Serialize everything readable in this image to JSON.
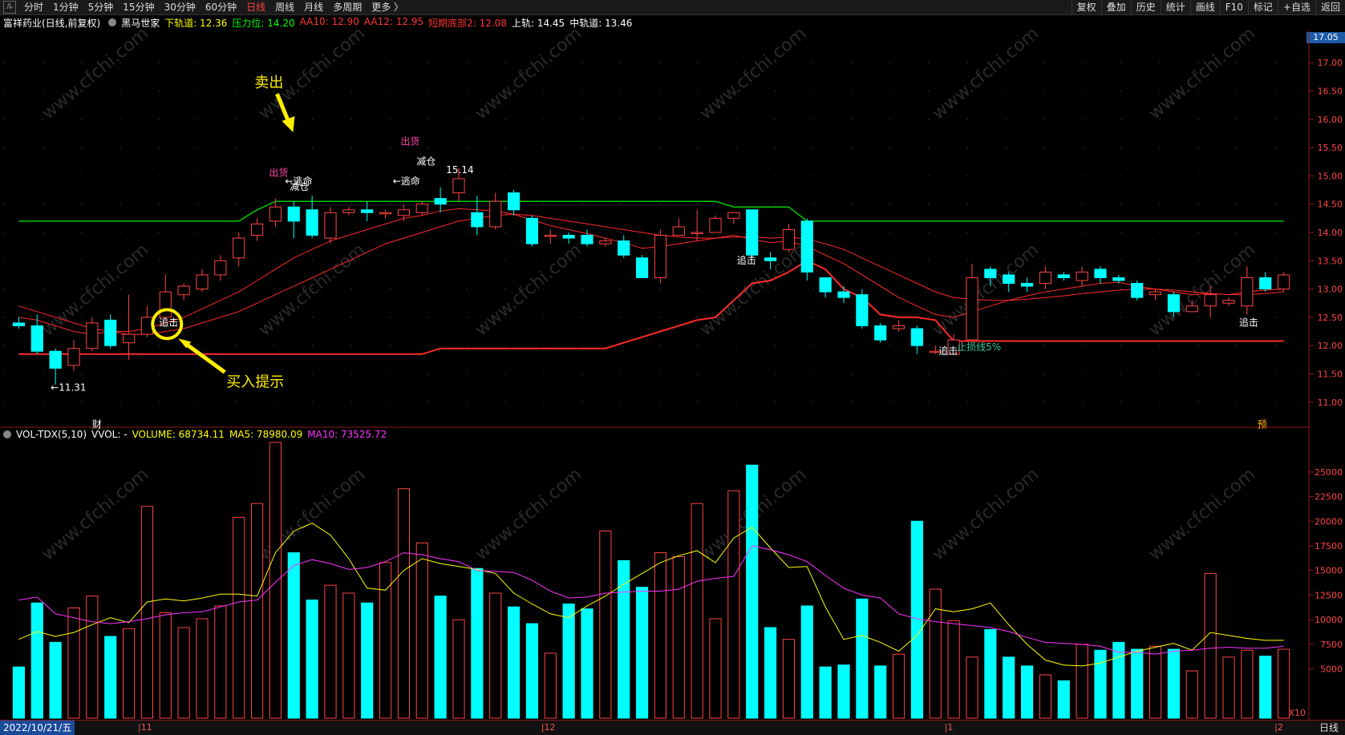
{
  "topbar": {
    "logo": "ル",
    "tabs": [
      "分时",
      "1分钟",
      "5分钟",
      "15分钟",
      "30分钟",
      "60分钟",
      "日线",
      "周线",
      "月线",
      "多周期",
      "更多 〉"
    ],
    "active_tab": "日线",
    "right_buttons": [
      "复权",
      "叠加",
      "历史",
      "统计",
      "画线",
      "F10",
      "标记",
      "+自选",
      "返回"
    ]
  },
  "info": {
    "title": "富祥药业(日线,前复权)",
    "indicator": "黑马世家",
    "items": [
      {
        "label": "下轨道: 12.36",
        "color": "#ffff00"
      },
      {
        "label": "压力位: 14.20",
        "color": "#00ff00"
      },
      {
        "label": "AA10: 12.90",
        "color": "#ff3333"
      },
      {
        "label": "AA12: 12.95",
        "color": "#ff3333"
      },
      {
        "label": "短期底部2: 12.08",
        "color": "#ff3333"
      },
      {
        "label": "上轨: 14.45",
        "color": "#ffffff"
      },
      {
        "label": "中轨道: 13.46",
        "color": "#ffffff"
      }
    ],
    "current_price": "17.05"
  },
  "vol_info": {
    "name": "VOL-TDX(5,10)",
    "vvol": "VVOL: -",
    "volume": "VOLUME: 68734.11",
    "ma5": "MA5: 78980.09",
    "ma10": "MA10: 73525.72"
  },
  "annotations": {
    "sell_label": "卖出",
    "buy_label": "买入提示",
    "chuhuo1": "出货",
    "chuhuo2": "出货",
    "jiancang1": "减仓",
    "jiancang2": "减仓",
    "taoming1": "←逃命",
    "taoming2": "←逃命",
    "zhuiji1": "追击",
    "zhuiji2": "追击",
    "zhuiji3": "追击",
    "zhuiji4": "追击",
    "low_label": "←11.31",
    "high_label": "15.14",
    "zhisun": "止损线5%",
    "cai": "财",
    "yu": "预",
    "x10": "X10",
    "watermark": "www.cfchi.com"
  },
  "bottom": {
    "date": "2022/10/21/五",
    "months": [
      "11",
      "12",
      "1",
      "2"
    ],
    "period": "日线"
  },
  "colors": {
    "up": "#ff4444",
    "down": "#00ffff",
    "ma_red": "#ff2a2a",
    "resist": "#00cc00",
    "ma5": "#ffff00",
    "ma10": "#ff33ff"
  },
  "chart_data": [
    {
      "type": "candlestick",
      "yaxis_ticks": [
        11.0,
        11.5,
        12.0,
        12.5,
        13.0,
        13.5,
        14.0,
        14.5,
        15.0,
        15.5,
        16.0,
        16.5,
        17.0
      ],
      "ylim": [
        10.6,
        17.4
      ],
      "candles": [
        [
          12.4,
          12.35,
          12.5,
          12.3
        ],
        [
          12.35,
          11.9,
          12.55,
          11.85
        ],
        [
          11.9,
          11.6,
          11.95,
          11.31
        ],
        [
          11.65,
          11.95,
          12.1,
          11.55
        ],
        [
          11.95,
          12.4,
          12.5,
          11.9
        ],
        [
          12.45,
          12.0,
          12.55,
          11.95
        ],
        [
          12.05,
          12.2,
          12.9,
          11.75
        ],
        [
          12.2,
          12.5,
          12.7,
          12.15
        ],
        [
          12.5,
          12.95,
          13.25,
          12.45
        ],
        [
          12.9,
          13.05,
          13.1,
          12.8
        ],
        [
          13.0,
          13.25,
          13.35,
          12.95
        ],
        [
          13.25,
          13.5,
          13.6,
          13.15
        ],
        [
          13.55,
          13.9,
          14.0,
          13.4
        ],
        [
          13.95,
          14.15,
          14.25,
          13.85
        ],
        [
          14.2,
          14.45,
          14.6,
          14.1
        ],
        [
          14.45,
          14.2,
          14.55,
          13.9
        ],
        [
          14.4,
          13.95,
          14.65,
          13.9
        ],
        [
          13.9,
          14.35,
          14.45,
          13.8
        ],
        [
          14.35,
          14.4,
          14.45,
          14.3
        ],
        [
          14.4,
          14.35,
          14.55,
          14.2
        ],
        [
          14.35,
          14.35,
          14.4,
          14.25
        ],
        [
          14.3,
          14.4,
          14.5,
          14.2
        ],
        [
          14.35,
          14.5,
          14.55,
          14.3
        ],
        [
          14.6,
          14.5,
          14.8,
          14.35
        ],
        [
          14.7,
          14.95,
          15.14,
          14.55
        ],
        [
          14.35,
          14.1,
          14.65,
          13.95
        ],
        [
          14.1,
          14.55,
          14.7,
          14.05
        ],
        [
          14.7,
          14.4,
          14.75,
          14.3
        ],
        [
          14.25,
          13.8,
          14.3,
          13.75
        ],
        [
          13.95,
          13.95,
          14.05,
          13.8
        ],
        [
          13.95,
          13.9,
          14.0,
          13.8
        ],
        [
          13.95,
          13.8,
          14.05,
          13.75
        ],
        [
          13.8,
          13.85,
          13.9,
          13.75
        ],
        [
          13.85,
          13.6,
          13.95,
          13.55
        ],
        [
          13.55,
          13.2,
          13.6,
          13.2
        ],
        [
          13.2,
          13.95,
          14.05,
          13.1
        ],
        [
          13.95,
          14.1,
          14.25,
          13.95
        ],
        [
          14.0,
          14.0,
          14.4,
          13.85
        ],
        [
          14.0,
          14.25,
          14.3,
          14.0
        ],
        [
          14.25,
          14.35,
          14.35,
          14.15
        ],
        [
          14.4,
          13.6,
          14.4,
          13.55
        ],
        [
          13.55,
          13.5,
          13.65,
          13.35
        ],
        [
          13.7,
          14.05,
          14.15,
          13.65
        ],
        [
          14.2,
          13.3,
          14.25,
          13.15
        ],
        [
          13.2,
          12.95,
          13.2,
          12.85
        ],
        [
          12.95,
          12.85,
          13.05,
          12.75
        ],
        [
          12.9,
          12.35,
          13.0,
          12.3
        ],
        [
          12.35,
          12.1,
          12.4,
          12.05
        ],
        [
          12.3,
          12.35,
          12.45,
          12.25
        ],
        [
          12.3,
          12.0,
          12.35,
          11.85
        ],
        [
          11.9,
          11.9,
          12.0,
          11.85
        ],
        [
          11.85,
          12.1,
          12.2,
          11.85
        ],
        [
          12.1,
          13.2,
          13.45,
          12.1
        ],
        [
          13.35,
          13.2,
          13.4,
          13.05
        ],
        [
          13.25,
          13.1,
          13.3,
          12.95
        ],
        [
          13.1,
          13.05,
          13.2,
          12.95
        ],
        [
          13.1,
          13.3,
          13.4,
          13.0
        ],
        [
          13.25,
          13.2,
          13.3,
          13.15
        ],
        [
          13.15,
          13.3,
          13.4,
          13.05
        ],
        [
          13.35,
          13.2,
          13.4,
          13.1
        ],
        [
          13.2,
          13.15,
          13.25,
          13.1
        ],
        [
          13.1,
          12.85,
          13.15,
          12.8
        ],
        [
          12.9,
          12.95,
          13.0,
          12.8
        ],
        [
          12.9,
          12.6,
          12.95,
          12.5
        ],
        [
          12.6,
          12.7,
          12.8,
          12.6
        ],
        [
          12.7,
          12.9,
          13.05,
          12.5
        ],
        [
          12.75,
          12.8,
          12.85,
          12.7
        ],
        [
          12.7,
          13.2,
          13.4,
          12.55
        ],
        [
          13.2,
          13.0,
          13.3,
          12.95
        ],
        [
          13.0,
          13.25,
          13.3,
          12.95
        ]
      ],
      "ma_red1": [
        12.5,
        12.45,
        12.35,
        12.25,
        12.2,
        12.25,
        12.25,
        12.3,
        12.4,
        12.5,
        12.65,
        12.8,
        12.95,
        13.15,
        13.35,
        13.55,
        13.7,
        13.85,
        13.95,
        14.05,
        14.15,
        14.25,
        14.3,
        14.38,
        14.42,
        14.4,
        14.38,
        14.32,
        14.22,
        14.12,
        14.05,
        13.98,
        13.9,
        13.82,
        13.72,
        13.75,
        13.8,
        13.85,
        13.9,
        13.95,
        13.88,
        13.82,
        13.85,
        13.75,
        13.6,
        13.45,
        13.25,
        13.05,
        12.85,
        12.7,
        12.55,
        12.5,
        12.6,
        12.7,
        12.8,
        12.88,
        12.95,
        13.0,
        13.05,
        13.1,
        13.12,
        13.05,
        13.0,
        12.95,
        12.9,
        12.92,
        12.9,
        12.95,
        12.98,
        13.0
      ],
      "ma_red2": [
        12.7,
        12.6,
        12.5,
        12.4,
        12.3,
        12.25,
        12.2,
        12.2,
        12.25,
        12.3,
        12.4,
        12.5,
        12.6,
        12.75,
        12.9,
        13.05,
        13.2,
        13.35,
        13.5,
        13.65,
        13.8,
        13.9,
        14.0,
        14.1,
        14.2,
        14.25,
        14.3,
        14.32,
        14.3,
        14.25,
        14.2,
        14.15,
        14.1,
        14.05,
        14.0,
        13.95,
        13.92,
        13.9,
        13.9,
        13.92,
        13.92,
        13.9,
        13.92,
        13.88,
        13.8,
        13.7,
        13.55,
        13.4,
        13.25,
        13.1,
        12.95,
        12.85,
        12.82,
        12.8,
        12.8,
        12.82,
        12.85,
        12.88,
        12.92,
        12.95,
        12.98,
        13.0,
        13.0,
        12.98,
        12.95,
        12.92,
        12.9,
        12.9,
        12.92,
        12.95
      ],
      "support_line": [
        11.85,
        11.85,
        11.85,
        11.85,
        11.85,
        11.85,
        11.85,
        11.85,
        11.85,
        11.85,
        11.85,
        11.85,
        11.85,
        11.85,
        11.85,
        11.85,
        11.85,
        11.85,
        11.85,
        11.85,
        11.85,
        11.85,
        11.85,
        11.95,
        11.95,
        11.95,
        11.95,
        11.95,
        11.95,
        11.95,
        11.95,
        11.95,
        11.95,
        12.05,
        12.15,
        12.25,
        12.35,
        12.45,
        12.5,
        12.8,
        13.1,
        13.15,
        13.3,
        13.5,
        13.35,
        13.0,
        12.85,
        12.55,
        12.5,
        12.5,
        12.45,
        12.08,
        12.08,
        12.08,
        12.08,
        12.08,
        12.08,
        12.08,
        12.08,
        12.08,
        12.08,
        12.08,
        12.08,
        12.08,
        12.08,
        12.08,
        12.08,
        12.08,
        12.08,
        12.08
      ],
      "resist_line": [
        14.2,
        14.2,
        14.2,
        14.2,
        14.2,
        14.2,
        14.2,
        14.2,
        14.2,
        14.2,
        14.2,
        14.2,
        14.2,
        14.4,
        14.55,
        14.55,
        14.55,
        14.55,
        14.55,
        14.55,
        14.55,
        14.55,
        14.55,
        14.55,
        14.55,
        14.55,
        14.55,
        14.55,
        14.55,
        14.55,
        14.55,
        14.55,
        14.55,
        14.55,
        14.55,
        14.55,
        14.55,
        14.55,
        14.55,
        14.45,
        14.45,
        14.45,
        14.45,
        14.2,
        14.2,
        14.2,
        14.2,
        14.2,
        14.2,
        14.2,
        14.2,
        14.2,
        14.2,
        14.2,
        14.2,
        14.2,
        14.2,
        14.2,
        14.2,
        14.2,
        14.2,
        14.2,
        14.2,
        14.2,
        14.2,
        14.2,
        14.2,
        14.2,
        14.2,
        14.2
      ]
    },
    {
      "type": "bar",
      "yaxis_ticks": [
        5000,
        7500,
        10000,
        12500,
        15000,
        17500,
        20000,
        22500,
        25000
      ],
      "ylim": [
        0,
        28000
      ],
      "volumes": [
        5200,
        11700,
        7700,
        11200,
        12400,
        8300,
        9100,
        21500,
        10700,
        9200,
        10100,
        11400,
        20400,
        21800,
        28000,
        16800,
        12000,
        13500,
        12700,
        11700,
        15800,
        23300,
        17800,
        12400,
        10000,
        15200,
        12700,
        11300,
        9600,
        6600,
        11600,
        11100,
        19000,
        16000,
        13300,
        16800,
        16400,
        21800,
        10100,
        23100,
        25700,
        9200,
        8000,
        11400,
        5200,
        5400,
        12100,
        5300,
        6500,
        20000,
        13100,
        9900,
        6200,
        9000,
        6200,
        5300,
        4400,
        3800,
        7500,
        6900,
        7700,
        7000,
        7300,
        7000,
        4800,
        14700,
        6200,
        6900,
        6300,
        7000
      ],
      "ma5": [
        8000,
        8800,
        8300,
        8700,
        9500,
        10200,
        9700,
        11800,
        12100,
        11900,
        12200,
        12600,
        12600,
        12400,
        16800,
        19000,
        19800,
        18600,
        16200,
        13200,
        13000,
        15000,
        16200,
        15700,
        15400,
        15100,
        14700,
        12700,
        11600,
        10600,
        10200,
        11400,
        12400,
        13600,
        14700,
        15800,
        16500,
        17000,
        15800,
        18300,
        19400,
        17300,
        15300,
        15400,
        11300,
        8000,
        8400,
        7700,
        6800,
        8400,
        11100,
        10800,
        11100,
        11700,
        9500,
        7500,
        5900,
        5400,
        5300,
        5600,
        6200,
        6800,
        7200,
        7600,
        6900,
        8700,
        8400,
        8100,
        7900,
        7900
      ],
      "ma10": [
        12000,
        12300,
        10600,
        10200,
        9800,
        9600,
        9800,
        10100,
        10500,
        10700,
        10800,
        11300,
        11800,
        12000,
        13800,
        15500,
        16100,
        15700,
        15100,
        15300,
        15900,
        16800,
        16600,
        16200,
        15900,
        15000,
        14900,
        14800,
        14000,
        12900,
        12200,
        12300,
        12700,
        12800,
        12900,
        12900,
        13100,
        13900,
        14200,
        14400,
        17500,
        17100,
        16600,
        15900,
        14500,
        13200,
        12500,
        12200,
        10600,
        10100,
        9800,
        9600,
        9400,
        9200,
        8800,
        8200,
        7700,
        7600,
        7500,
        7300,
        6700,
        6700,
        6500,
        6800,
        6900,
        7100,
        7200,
        7100,
        7100,
        7300
      ]
    }
  ]
}
